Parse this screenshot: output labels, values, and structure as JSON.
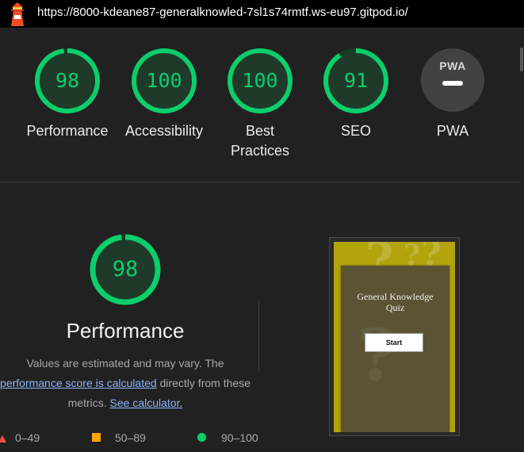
{
  "address_bar": {
    "url": "https://8000-kdeane87-generalknowled-7sl1s74rmtf.ws-eu97.gitpod.io/"
  },
  "colors": {
    "pass": "#0cce6b",
    "average": "#ffa400",
    "fail": "#ff4e42",
    "background": "#212121"
  },
  "scores": [
    {
      "value": "98",
      "fraction": 0.98,
      "label": "Performance"
    },
    {
      "value": "100",
      "fraction": 1.0,
      "label": "Accessibility"
    },
    {
      "value": "100",
      "fraction": 1.0,
      "label": "Best Practices",
      "label_line1": "Best",
      "label_line2": "Practices"
    },
    {
      "value": "91",
      "fraction": 0.91,
      "label": "SEO"
    }
  ],
  "pwa": {
    "badge_text": "PWA",
    "label": "PWA",
    "icon": "pwa-badge-icon"
  },
  "performance_section": {
    "score": "98",
    "fraction": 0.98,
    "title": "Performance",
    "desc_line1": "Values are estimated and may vary. The",
    "desc_link1": "performance score is calculated",
    "desc_after_link1": " directly from these",
    "desc_line3_prefix": "metrics. ",
    "desc_link2": "See calculator."
  },
  "legend": [
    {
      "range": "0–49",
      "icon": "fail-triangle-icon"
    },
    {
      "range": "50–89",
      "icon": "average-square-icon"
    },
    {
      "range": "90–100",
      "icon": "pass-circle-icon"
    }
  ],
  "screenshot_preview": {
    "title": "General Knowledge Quiz",
    "title_line1": "General Knowledge",
    "title_line2": "Quiz",
    "button": "Start"
  }
}
